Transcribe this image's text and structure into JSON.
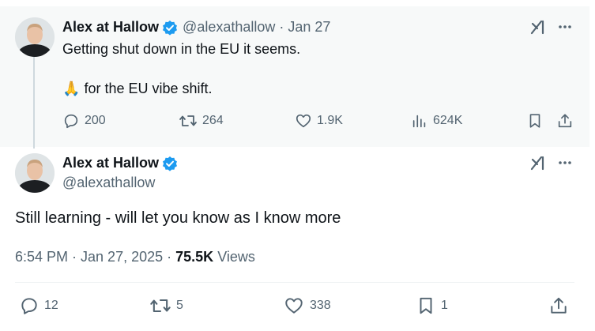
{
  "parent": {
    "display_name": "Alex at Hallow",
    "handle": "@alexathallow",
    "separator": "·",
    "date": "Jan 27",
    "text_line1": "Getting shut down in the EU it seems.",
    "text_line2_emoji": "🙏",
    "text_line2": "for the EU vibe shift.",
    "replies": "200",
    "reposts": "264",
    "likes": "1.9K",
    "views": "624K"
  },
  "main": {
    "display_name": "Alex at Hallow",
    "handle": "@alexathallow",
    "text": "Still learning - will let you know as I know more",
    "time": "6:54 PM · Jan 27, 2025 · ",
    "views_count": "75.5K",
    "views_label": "Views",
    "replies": "12",
    "reposts": "5",
    "likes": "338",
    "bookmarks": "1"
  },
  "colors": {
    "verified": "#1d9bf0",
    "secondary_text": "#536471",
    "parent_bg": "#f7f9f9",
    "thread_line": "#cfd9de"
  },
  "icons": [
    "verified-badge-icon",
    "grok-icon",
    "more-icon",
    "reply-icon",
    "repost-icon",
    "like-icon",
    "views-icon",
    "bookmark-icon",
    "share-icon"
  ]
}
